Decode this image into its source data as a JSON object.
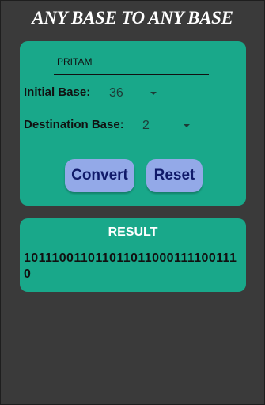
{
  "app": {
    "title": "ANY BASE TO ANY BASE"
  },
  "form": {
    "input_value": "PRITAM",
    "initial_base_label": "Initial Base:",
    "initial_base_value": "36",
    "destination_base_label": "Destination Base:",
    "destination_base_value": "2",
    "convert_label": "Convert",
    "reset_label": "Reset"
  },
  "result": {
    "title": "RESULT",
    "value": "1011100110110110110001111001110"
  },
  "colors": {
    "background": "#3a3a3a",
    "card": "#19a88a",
    "button": "#93a9e8",
    "button_text": "#101a6a"
  }
}
